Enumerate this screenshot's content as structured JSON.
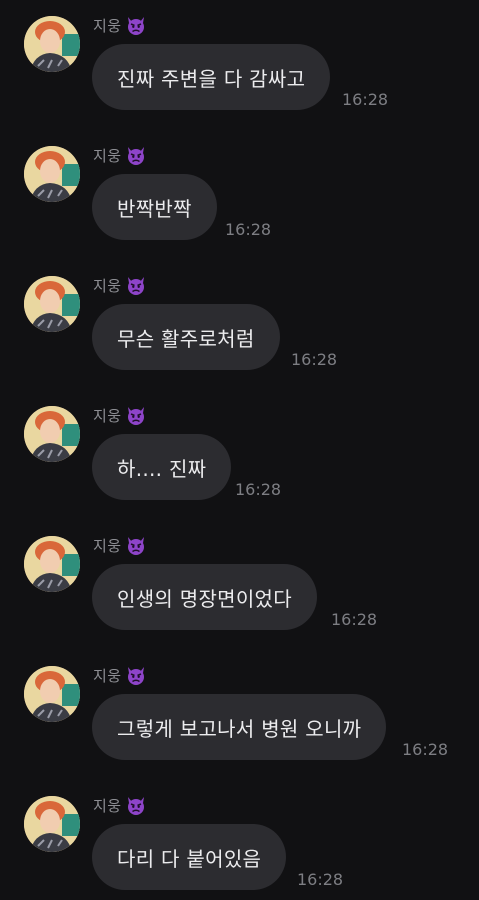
{
  "chat": {
    "messages": [
      {
        "sender": "지웅",
        "text": "진짜 주변을 다 감싸고",
        "time": "16:28"
      },
      {
        "sender": "지웅",
        "text": "반짝반짝",
        "time": "16:28"
      },
      {
        "sender": "지웅",
        "text": "무슨 활주로처럼",
        "time": "16:28"
      },
      {
        "sender": "지웅",
        "text": "하.... 진짜",
        "time": "16:28"
      },
      {
        "sender": "지웅",
        "text": "인생의 명장면이었다",
        "time": "16:28"
      },
      {
        "sender": "지웅",
        "text": "그렇게 보고나서 병원 오니까",
        "time": "16:28"
      },
      {
        "sender": "지웅",
        "text": "다리 다 붙어있음",
        "time": "16:28"
      }
    ]
  },
  "icons": {
    "sender_badge": "angry-devil-face-icon",
    "avatar": "profile-photo-avatar"
  },
  "colors": {
    "background": "#111113",
    "bubble": "#2c2c30",
    "bubble_text": "#ececee",
    "sender_text": "#8d8e93",
    "timestamp_text": "#7d7e83",
    "devil_purple": "#8e44c9"
  }
}
